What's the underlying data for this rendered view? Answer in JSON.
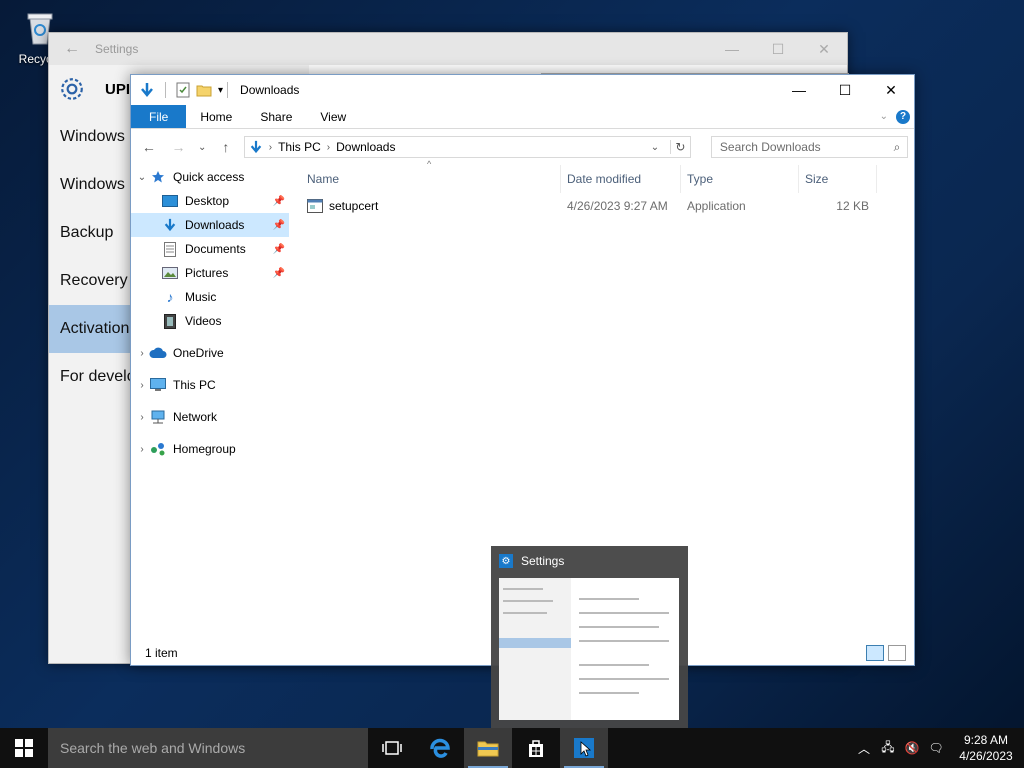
{
  "desktop": {
    "recycle_label": "Recycle"
  },
  "settings_window": {
    "title": "Settings",
    "section_label": "UPI",
    "nav_items": [
      "Windows U",
      "Windows D",
      "Backup",
      "Recovery",
      "Activation",
      "For develo"
    ]
  },
  "explorer": {
    "title": "Downloads",
    "ribbon_tabs": [
      "File",
      "Home",
      "Share",
      "View"
    ],
    "address": {
      "segments": [
        "This PC",
        "Downloads"
      ]
    },
    "search": {
      "placeholder": "Search Downloads"
    },
    "nav": {
      "quick_access": "Quick access",
      "quick_items": [
        "Desktop",
        "Downloads",
        "Documents",
        "Pictures",
        "Music",
        "Videos"
      ],
      "onedrive": "OneDrive",
      "this_pc": "This PC",
      "network": "Network",
      "homegroup": "Homegroup"
    },
    "columns": [
      "Name",
      "Date modified",
      "Type",
      "Size"
    ],
    "files": [
      {
        "name": "setupcert",
        "date": "4/26/2023 9:27 AM",
        "type": "Application",
        "size": "12 KB"
      }
    ],
    "status": "1 item"
  },
  "thumbnail": {
    "title": "Settings"
  },
  "taskbar": {
    "search_placeholder": "Search the web and Windows",
    "time": "9:28 AM",
    "date": "4/26/2023"
  }
}
